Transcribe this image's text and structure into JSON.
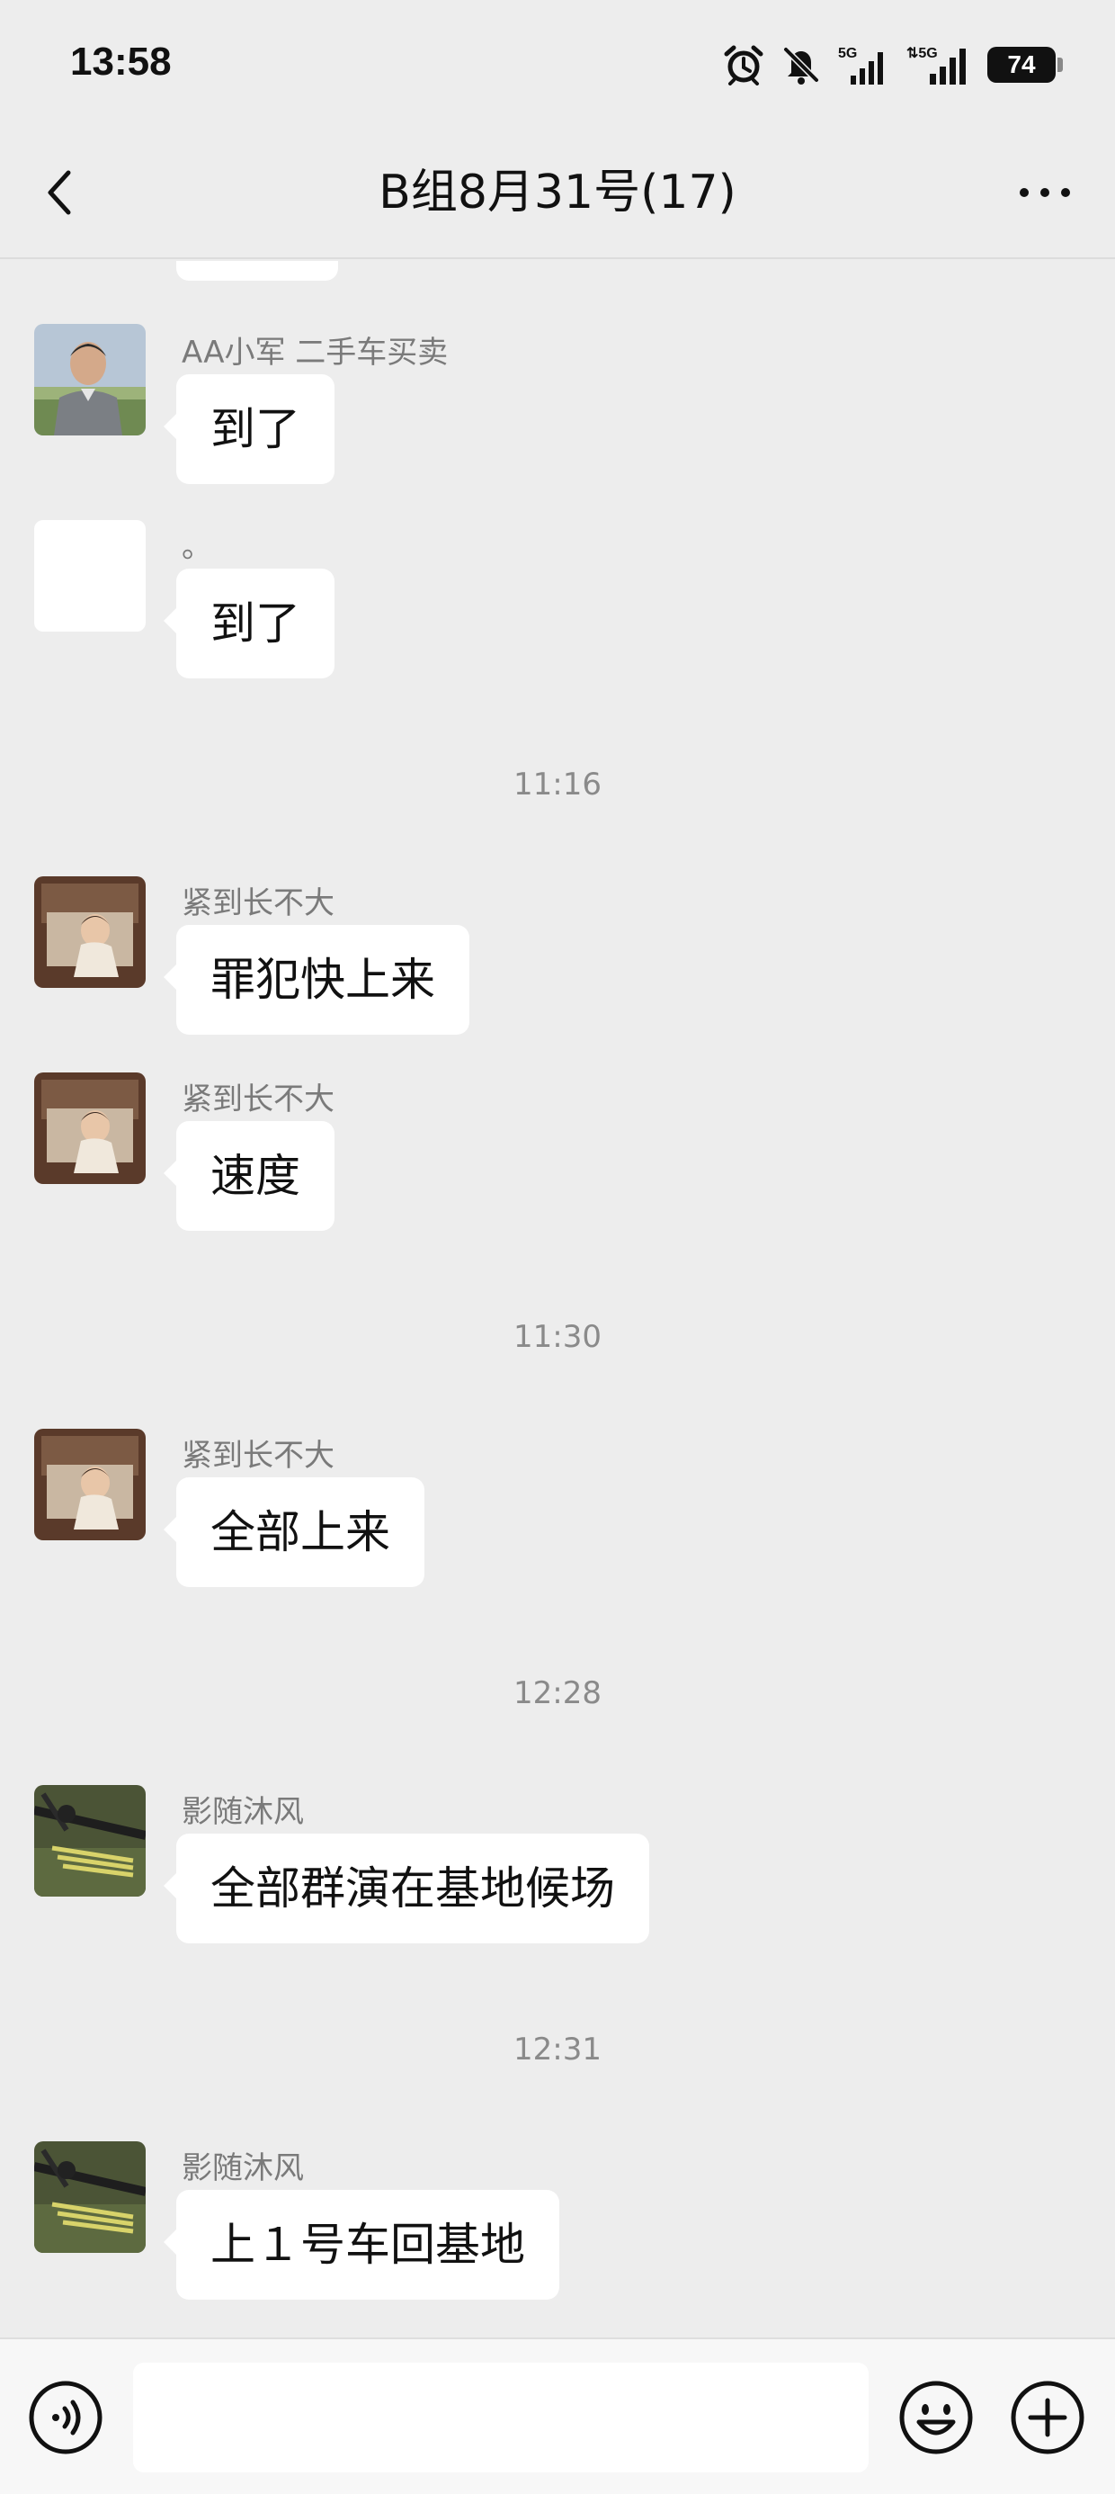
{
  "status_bar": {
    "time": "13:58",
    "battery": "74",
    "icons": [
      "alarm-icon",
      "mute-bell-icon",
      "5g-signal-icon",
      "5g-signal-icon",
      "battery-icon"
    ]
  },
  "header": {
    "title": "B组8月31号(17)",
    "back_icon": "chevron-left-icon",
    "more_icon": "more-dots-icon"
  },
  "messages": [
    {
      "type": "message",
      "sender": "AA小军 二手车买卖",
      "text": "到了",
      "avatar": "man-photo-avatar"
    },
    {
      "type": "message",
      "sender": "。",
      "text": "到了",
      "avatar": "blank-white-avatar"
    },
    {
      "type": "time",
      "text": "11:16"
    },
    {
      "type": "message",
      "sender": "紧到长不大",
      "text": "罪犯快上来",
      "avatar": "baby-photo-avatar"
    },
    {
      "type": "message",
      "sender": "紧到长不大",
      "text": "速度",
      "avatar": "baby-photo-avatar"
    },
    {
      "type": "time",
      "text": "11:30"
    },
    {
      "type": "message",
      "sender": "紧到长不大",
      "text": "全部上来",
      "avatar": "baby-photo-avatar"
    },
    {
      "type": "time",
      "text": "12:28"
    },
    {
      "type": "message",
      "sender": "影随沐风",
      "text": "全部群演在基地候场",
      "avatar": "crossbow-photo-avatar"
    },
    {
      "type": "time",
      "text": "12:31"
    },
    {
      "type": "message",
      "sender": "影随沐风",
      "text": "上１号车回基地",
      "avatar": "crossbow-photo-avatar"
    }
  ],
  "input_bar": {
    "voice_icon": "voice-icon",
    "emoji_icon": "emoji-icon",
    "plus_icon": "plus-icon",
    "input_value": ""
  },
  "colors": {
    "background": "#ededed",
    "bubble": "#ffffff",
    "text": "#111111",
    "meta_text": "#7a7a7a"
  }
}
